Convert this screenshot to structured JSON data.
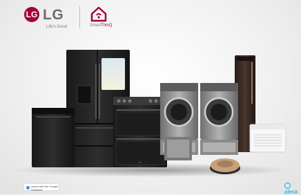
{
  "brand": {
    "name": "LG",
    "symbol": "LG",
    "tagline": "Life's Good",
    "smart_prefix": "Smart",
    "smart_suffix": "ThinQ",
    "brand_color": "#a50034"
  },
  "badges": {
    "google": "works with the Google Assistant",
    "alexa": "alexa"
  },
  "product_labels": {
    "range": "LG"
  },
  "colors": {
    "black_steel": "#1e1e1e",
    "stainless": "#9a9a9a",
    "styler": "#3a2a24",
    "robot": "#c9a07a",
    "alexa": "#00a8e1"
  },
  "icons": {
    "home": "home-icon",
    "google": "google-assistant-icon",
    "alexa": "alexa-icon"
  }
}
